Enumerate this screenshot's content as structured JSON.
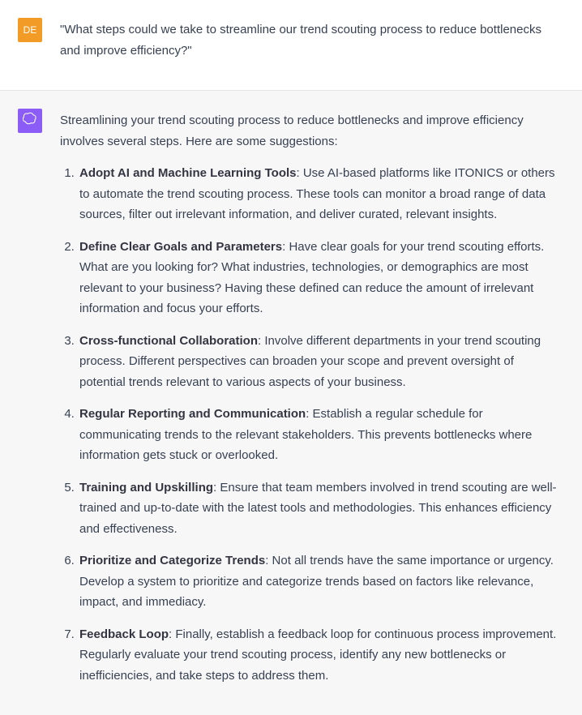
{
  "user": {
    "avatar_initials": "DE",
    "message": "\"What steps could we take to streamline our trend scouting process to reduce bottlenecks and improve efficiency?\""
  },
  "assistant": {
    "intro": "Streamlining your trend scouting process to reduce bottlenecks and improve efficiency involves several steps. Here are some suggestions:",
    "items": [
      {
        "title": "Adopt AI and Machine Learning Tools",
        "body": ": Use AI-based platforms like ITONICS or others to automate the trend scouting process. These tools can monitor a broad range of data sources, filter out irrelevant information, and deliver curated, relevant insights."
      },
      {
        "title": "Define Clear Goals and Parameters",
        "body": ": Have clear goals for your trend scouting efforts. What are you looking for? What industries, technologies, or demographics are most relevant to your business? Having these defined can reduce the amount of irrelevant information and focus your efforts."
      },
      {
        "title": "Cross-functional Collaboration",
        "body": ": Involve different departments in your trend scouting process. Different perspectives can broaden your scope and prevent oversight of potential trends relevant to various aspects of your business."
      },
      {
        "title": "Regular Reporting and Communication",
        "body": ": Establish a regular schedule for communicating trends to the relevant stakeholders. This prevents bottlenecks where information gets stuck or overlooked."
      },
      {
        "title": "Training and Upskilling",
        "body": ": Ensure that team members involved in trend scouting are well-trained and up-to-date with the latest tools and methodologies. This enhances efficiency and effectiveness."
      },
      {
        "title": "Prioritize and Categorize Trends",
        "body": ": Not all trends have the same importance or urgency. Develop a system to prioritize and categorize trends based on factors like relevance, impact, and immediacy."
      },
      {
        "title": "Feedback Loop",
        "body": ": Finally, establish a feedback loop for continuous process improvement. Regularly evaluate your trend scouting process, identify any new bottlenecks or inefficiencies, and take steps to address them."
      }
    ]
  }
}
